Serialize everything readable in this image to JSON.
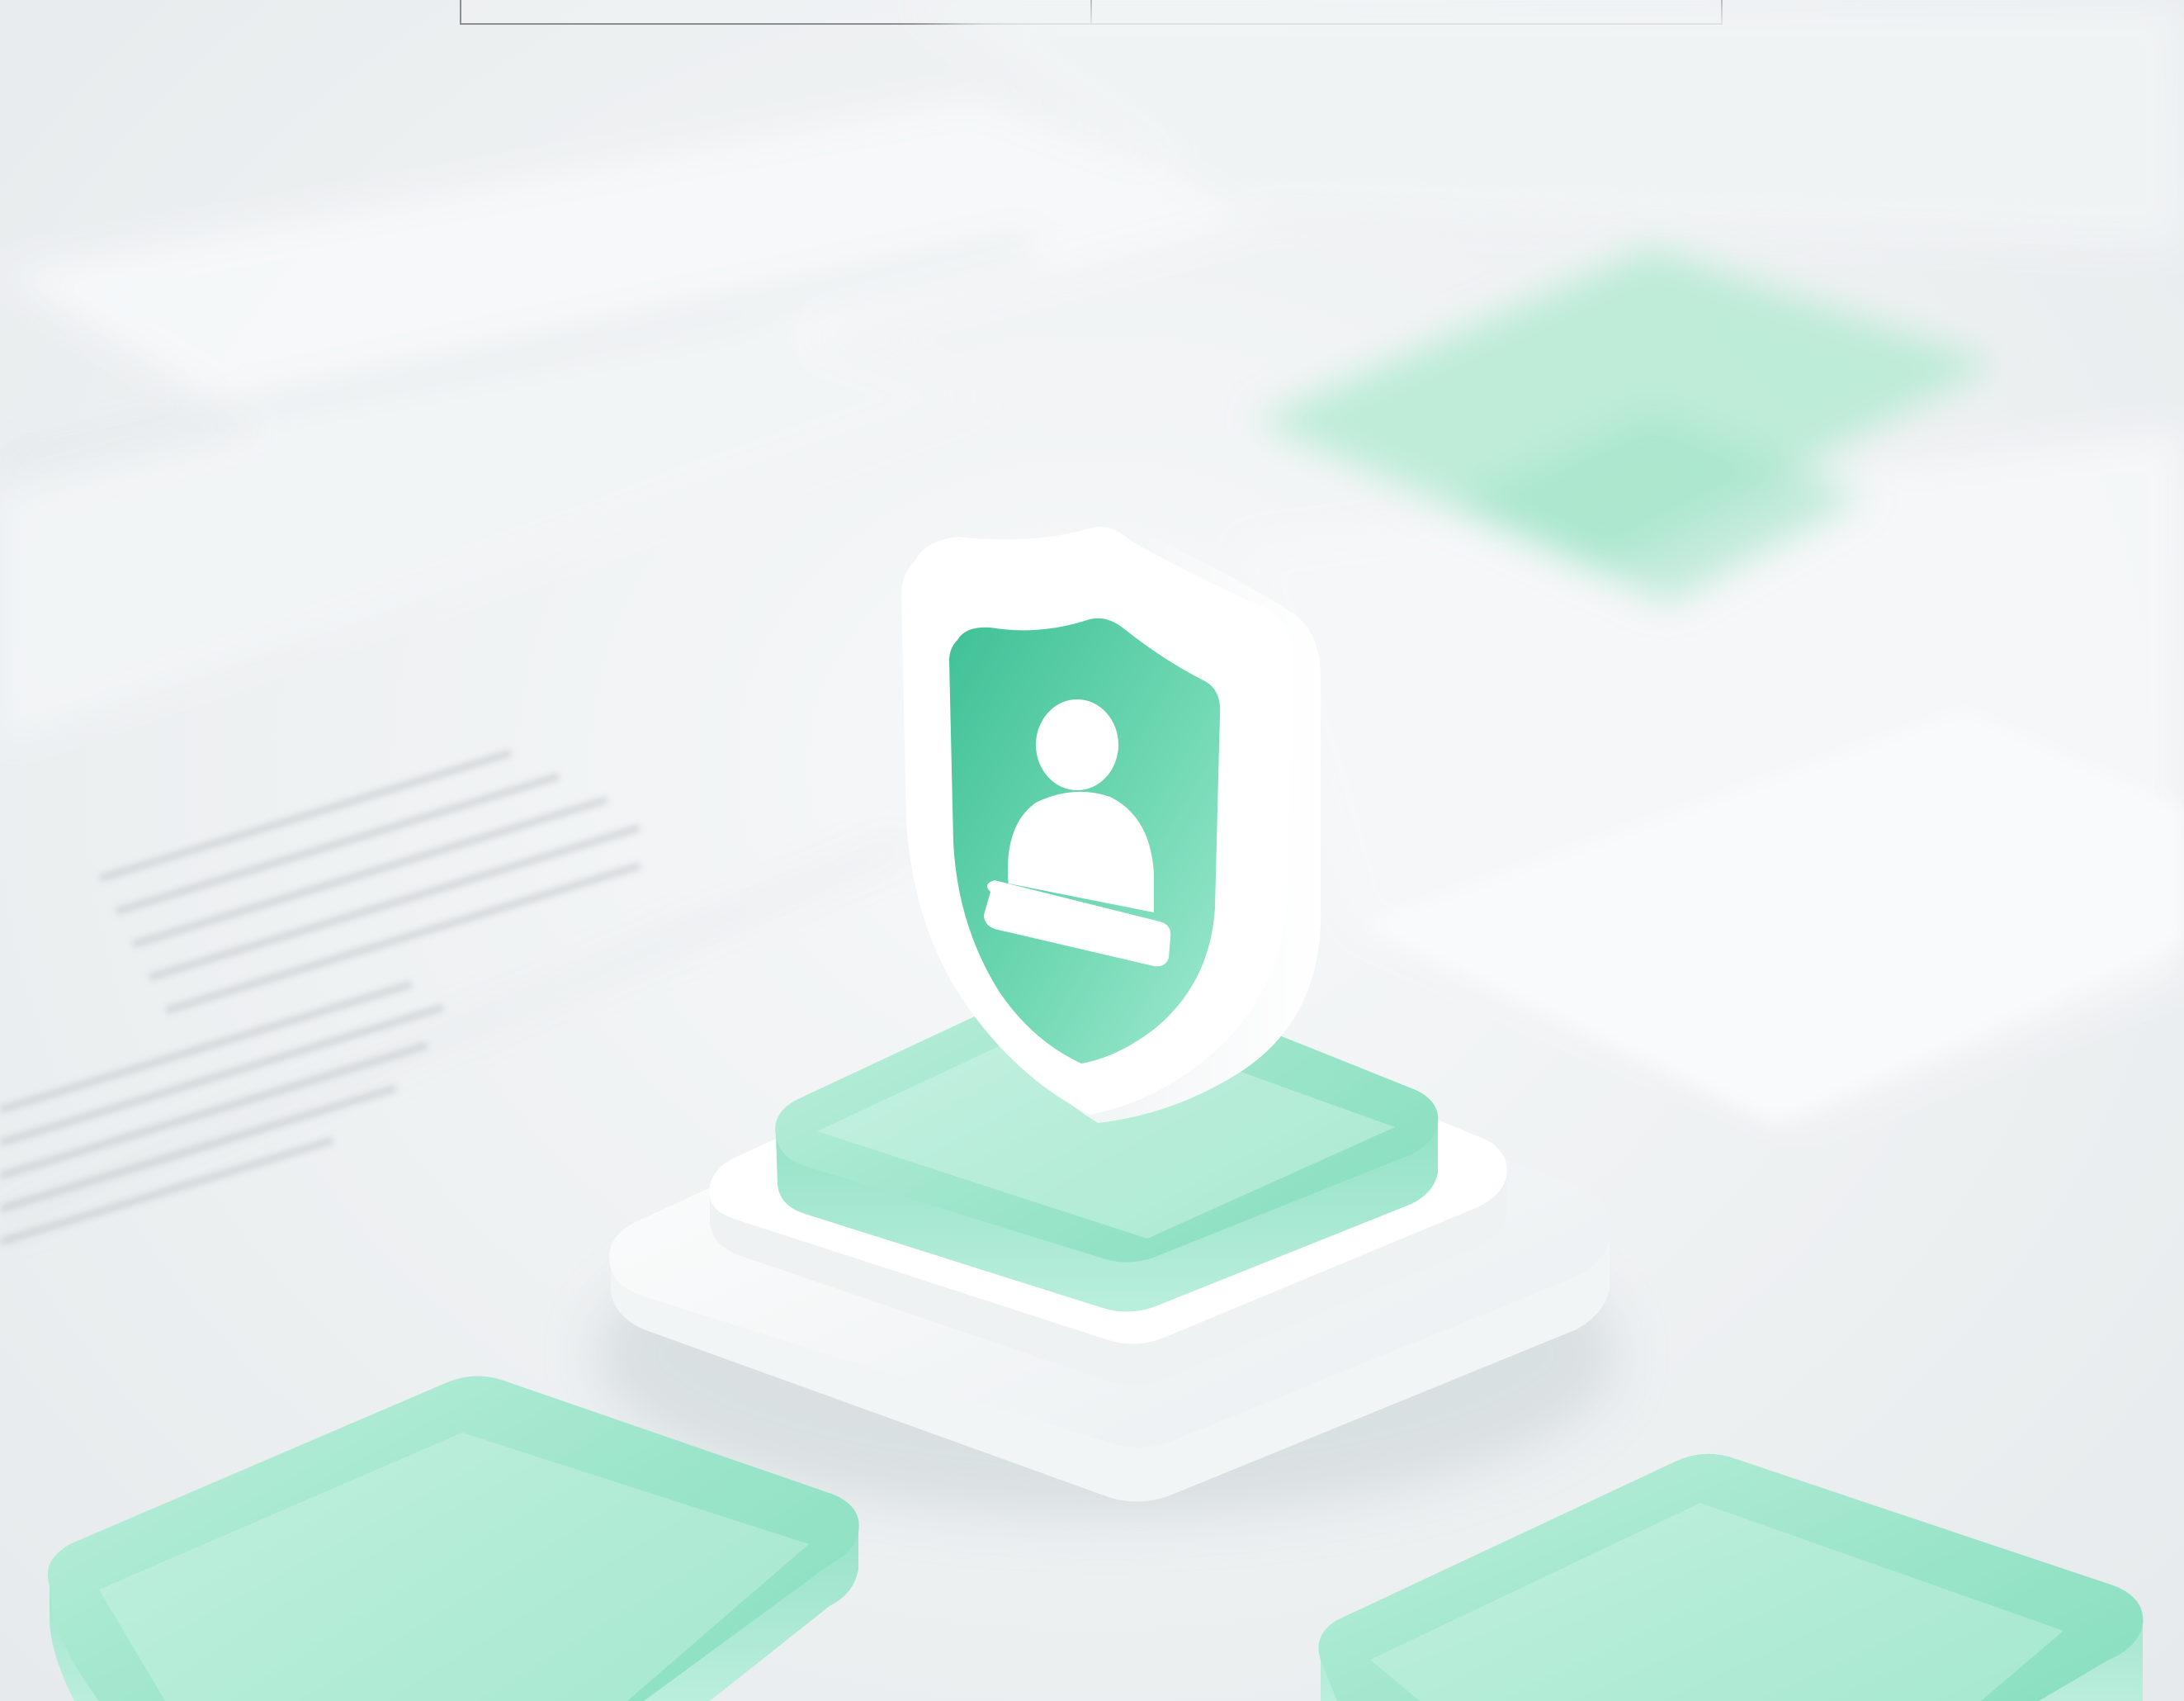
{
  "scene": {
    "subject": "shield-user-icon",
    "colors": {
      "background": "#eef1f2",
      "accent_mint": "#5fd1ac",
      "accent_mint_deep": "#2fb98b",
      "glass_mint": "#a9ead3",
      "white_plastic": "#fbfcfc",
      "table_border": "#8a8f93"
    }
  },
  "top_table": {
    "columns": [
      "",
      ""
    ]
  }
}
